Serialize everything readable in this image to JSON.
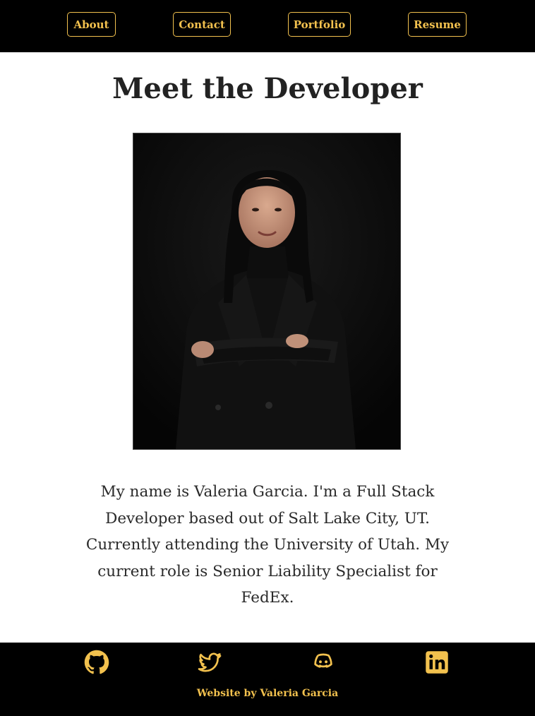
{
  "nav": {
    "about_label": "About",
    "contact_label": "Contact",
    "portfolio_label": "Portfolio",
    "resume_label": "Resume"
  },
  "hero": {
    "title": "Meet the Developer",
    "photo_alt": "Portrait of Valeria Garcia"
  },
  "bio": {
    "text": "My name is Valeria Garcia. I'm a Full Stack Developer based out of Salt Lake City, UT. Currently attending the University of Utah. My current role is Senior Liability Specialist for FedEx."
  },
  "footer": {
    "social": [
      {
        "icon": "github-icon"
      },
      {
        "icon": "twitter-icon"
      },
      {
        "icon": "discord-icon"
      },
      {
        "icon": "linkedin-icon"
      }
    ],
    "credit": "Website by Valeria Garcia"
  },
  "colors": {
    "accent": "#f2c14e",
    "nav_background": "#000000",
    "page_background": "#ffffff",
    "text": "#222222"
  }
}
